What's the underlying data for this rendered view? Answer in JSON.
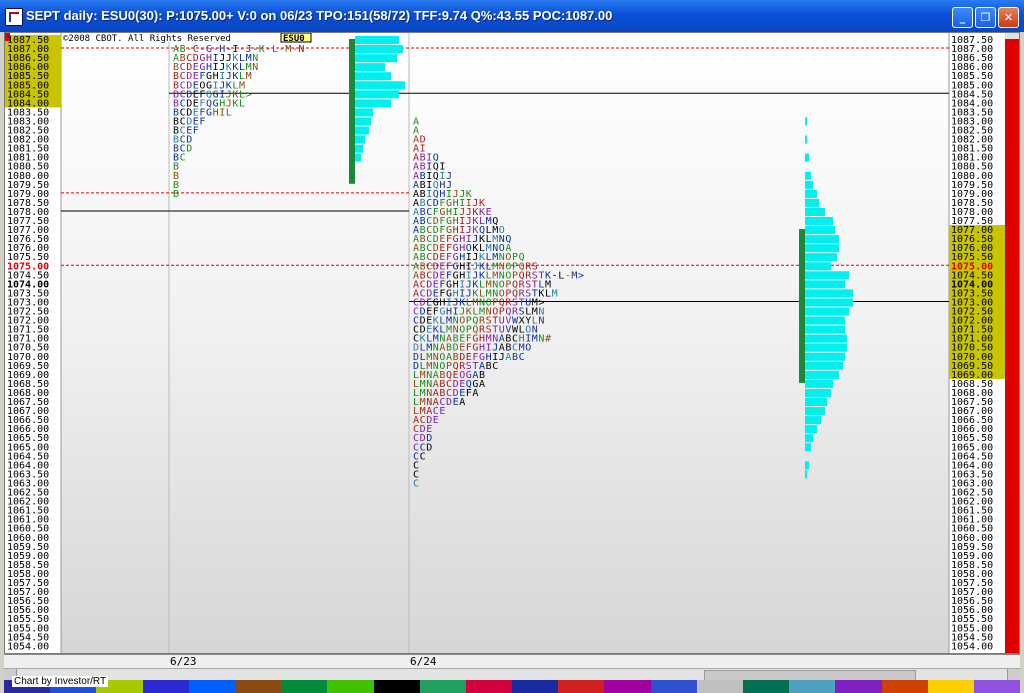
{
  "window": {
    "title": "SEPT daily: ESU0(30): P:1075.00+ V:0 on 06/23 TPO:151(58/72) TFF:9.74 Q%:43.55 POC:1087.00",
    "credit": "Chart by Investor/RT"
  },
  "chart": {
    "copyright": "©2008 CBOT. All Rights Reserved",
    "symbol": "ESU0",
    "current_price": "1075.00",
    "close_price": "1074.00",
    "price_min": 1054.0,
    "price_max": 1087.5,
    "tick": 0.5,
    "date_labels": [
      "6/23",
      "6/24"
    ],
    "day1_letters": [
      "AB-C-G-H-I-J-K-L-M-N",
      "ABCDGHIJJKLMN",
      "BCDEGHIJKKLMN",
      "BCDEFGHIJKLM",
      "BCDEOGIJKLM",
      "BCDEFQGIJKL>",
      "BCDEFQGHJKL",
      "BCDEFGHIL",
      "BCDEF",
      "BCEF",
      "BCD",
      "BCD",
      "BC",
      "B",
      "B",
      "B",
      "B"
    ],
    "day2_letters": [
      "A",
      "A",
      "AD",
      "AI",
      "ABIQ",
      "ABIQI",
      "ABIQIJ",
      "ABIQHJ",
      "ABIQHIJJK",
      "ABCDFGHIIJK",
      "ABCFGHIJJKKE",
      "ABCDFGHIJKLMQ",
      "ABCDFGHIJKQLMO",
      "ABCDEFGHIJKLMNQ",
      "ABCDEFGHOKLMNOA",
      "ABCDEFGHIJKLMNOPQ",
      "ABCDEFGHIJKLMNOPQRS",
      "ABCDEFGHIJKLMNOPQRSTK-L-M>",
      "ACDEFGHIJKLMNOPQRSTLM",
      "ACDEFGHIJKLMNOPQRSTKLM",
      "CDEGHIJKLMNOPQRSTUM>",
      "CDEFGHIJKLMNOPQRSLMN",
      "CDEKLMNOPQRSTUVWXYLN",
      "CDEKLMNOPQRSTUVWLON",
      "CKLMNABEFGHMNABCHIMN#",
      "DLMNABDEFGHIJABCMO",
      "DLMNOABDEFGHIJABC",
      "DLMNOPQRSTABC",
      "LMNABQEOGAB",
      "LMNABCDEQGA",
      "LMNABCDEFA",
      "LMNACDEA",
      "LMACE",
      "ACDE",
      "CDE",
      "CDD",
      "CCD",
      "CC",
      "C",
      "C",
      "C"
    ],
    "profile1": [
      [
        1087.5,
        44
      ],
      [
        1087.0,
        48
      ],
      [
        1086.5,
        42
      ],
      [
        1086.0,
        30
      ],
      [
        1085.5,
        36
      ],
      [
        1085.0,
        50
      ],
      [
        1084.5,
        44
      ],
      [
        1084.0,
        36
      ],
      [
        1083.5,
        18
      ],
      [
        1083.0,
        16
      ],
      [
        1082.5,
        14
      ],
      [
        1082.0,
        10
      ],
      [
        1081.5,
        8
      ],
      [
        1081.0,
        6
      ]
    ],
    "profile2": [
      [
        1083.0,
        2
      ],
      [
        1082.0,
        2
      ],
      [
        1081.0,
        4
      ],
      [
        1080.0,
        6
      ],
      [
        1079.5,
        8
      ],
      [
        1079.0,
        12
      ],
      [
        1078.5,
        14
      ],
      [
        1078.0,
        20
      ],
      [
        1077.5,
        28
      ],
      [
        1077.0,
        30
      ],
      [
        1076.5,
        34
      ],
      [
        1076.0,
        34
      ],
      [
        1075.5,
        32
      ],
      [
        1075.0,
        26
      ],
      [
        1074.5,
        44
      ],
      [
        1074.0,
        40
      ],
      [
        1073.5,
        48
      ],
      [
        1073.0,
        48
      ],
      [
        1072.5,
        44
      ],
      [
        1072.0,
        40
      ],
      [
        1071.5,
        40
      ],
      [
        1071.0,
        42
      ],
      [
        1070.5,
        42
      ],
      [
        1070.0,
        40
      ],
      [
        1069.5,
        38
      ],
      [
        1069.0,
        34
      ],
      [
        1068.5,
        28
      ],
      [
        1068.0,
        26
      ],
      [
        1067.5,
        22
      ],
      [
        1067.0,
        20
      ],
      [
        1066.5,
        16
      ],
      [
        1066.0,
        12
      ],
      [
        1065.5,
        8
      ],
      [
        1065.0,
        6
      ],
      [
        1064.0,
        4
      ],
      [
        1063.5,
        2
      ]
    ],
    "value_area1": [
      1084.0,
      1087.5
    ],
    "value_area2": [
      1069.0,
      1077.0
    ],
    "poc1": 1087.0,
    "poc2": 1075.0,
    "ib1": 1084.5,
    "ib2": 1073.0,
    "mid_lines": [
      1079.0,
      1078.0
    ]
  },
  "colors": {
    "axis_red": "#e00000",
    "axis_yellow": "#c8c000",
    "profile": "#00f0f0",
    "poc_green": "#1a8a3a",
    "scale_bg": "#ffffff"
  },
  "colorbar": [
    "#2a2aa0",
    "#2050e0",
    "#a8c800",
    "#2a2ad0",
    "#0060ff",
    "#8a4a14",
    "#008a3a",
    "#40c000",
    "#000000",
    "#20a060",
    "#d00040",
    "#1a2aa0",
    "#d02020",
    "#a000a0",
    "#3050d0",
    "#c0c0c0",
    "#007050",
    "#50a0c0",
    "#8020c0",
    "#d04000",
    "#ffd000",
    "#9050e0"
  ]
}
